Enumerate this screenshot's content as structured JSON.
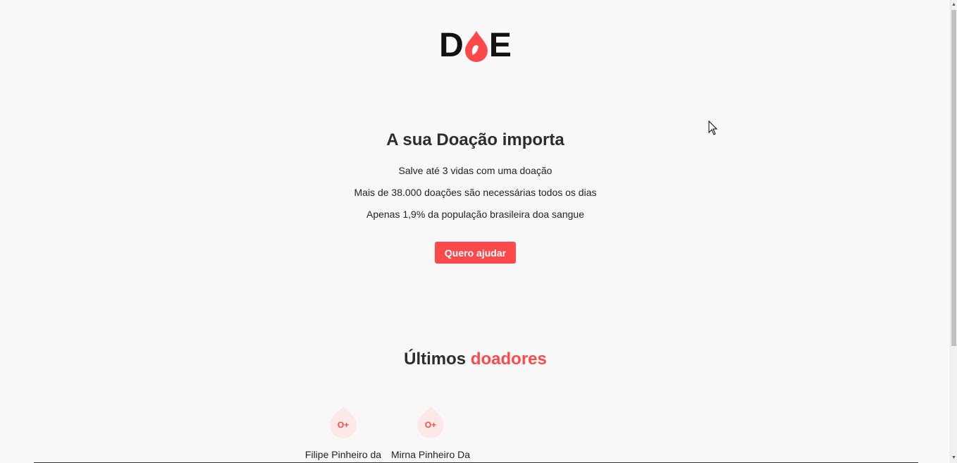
{
  "logo": {
    "letter_left": "D",
    "letter_right": "E",
    "drop_color": "#fc4a4c"
  },
  "hero": {
    "title": "A sua Doação importa",
    "lines": [
      "Salve até 3 vidas com uma doação",
      "Mais de 38.000 doações são necessárias todos os dias",
      "Apenas 1,9% da população brasileira doa sangue"
    ],
    "cta_label": "Quero ajudar"
  },
  "donors_section": {
    "title_prefix": "Últimos",
    "title_accent": "doadores",
    "donors": [
      {
        "blood_type": "O+",
        "name": "Filipe Pinheiro da"
      },
      {
        "blood_type": "O+",
        "name": "Mirna Pinheiro Da"
      }
    ]
  },
  "colors": {
    "accent": "#fc4a4c",
    "background": "#f8f8f8",
    "drop_light": "#fde8e8"
  },
  "icons": {
    "logo_drop": "blood-drop-icon",
    "donor_drop": "blood-drop-icon",
    "cursor": "mouse-pointer-icon"
  }
}
